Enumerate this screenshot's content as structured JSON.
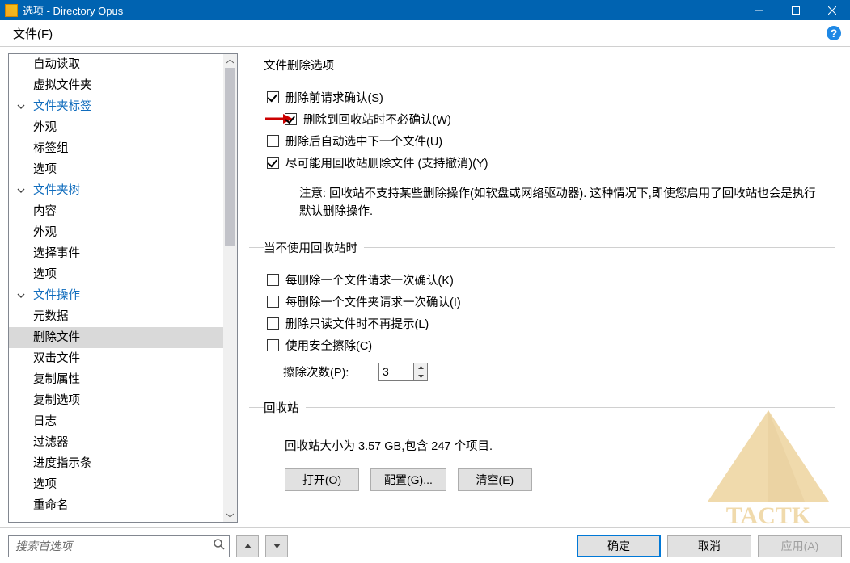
{
  "titlebar": {
    "text": "选项 - Directory Opus"
  },
  "menubar": {
    "file": "文件(F)"
  },
  "sidebar": {
    "items": [
      {
        "kind": "item",
        "label": "自动读取"
      },
      {
        "kind": "item",
        "label": "虚拟文件夹"
      },
      {
        "kind": "group",
        "label": "文件夹标签"
      },
      {
        "kind": "item",
        "label": "外观"
      },
      {
        "kind": "item",
        "label": "标签组"
      },
      {
        "kind": "item",
        "label": "选项"
      },
      {
        "kind": "group",
        "label": "文件夹树"
      },
      {
        "kind": "item",
        "label": "内容"
      },
      {
        "kind": "item",
        "label": "外观"
      },
      {
        "kind": "item",
        "label": "选择事件"
      },
      {
        "kind": "item",
        "label": "选项"
      },
      {
        "kind": "group",
        "label": "文件操作"
      },
      {
        "kind": "item",
        "label": "元数据"
      },
      {
        "kind": "item",
        "label": "删除文件",
        "selected": true
      },
      {
        "kind": "item",
        "label": "双击文件"
      },
      {
        "kind": "item",
        "label": "复制属性"
      },
      {
        "kind": "item",
        "label": "复制选项"
      },
      {
        "kind": "item",
        "label": "日志"
      },
      {
        "kind": "item",
        "label": "过滤器"
      },
      {
        "kind": "item",
        "label": "进度指示条"
      },
      {
        "kind": "item",
        "label": "选项"
      },
      {
        "kind": "item",
        "label": "重命名"
      }
    ]
  },
  "content": {
    "g1": {
      "legend": "文件删除选项",
      "c1": "删除前请求确认(S)",
      "c2": "删除到回收站时不必确认(W)",
      "c3": "删除后自动选中下一个文件(U)",
      "c4": "尽可能用回收站删除文件 (支持撤消)(Y)",
      "note": "注意: 回收站不支持某些删除操作(如软盘或网络驱动器). 这种情况下,即使您启用了回收站也会是执行默认删除操作."
    },
    "g2": {
      "legend": "当不使用回收站时",
      "c1": "每删除一个文件请求一次确认(K)",
      "c2": "每删除一个文件夹请求一次确认(I)",
      "c3": "删除只读文件时不再提示(L)",
      "c4": "使用安全擦除(C)",
      "spin_label": "擦除次数(P):",
      "spin_value": "3"
    },
    "g3": {
      "legend": "回收站",
      "info": "回收站大小为 3.57 GB,包含 247 个项目.",
      "b1": "打开(O)",
      "b2": "配置(G)...",
      "b3": "清空(E)"
    }
  },
  "footer": {
    "search_placeholder": "搜索首选项",
    "ok": "确定",
    "cancel": "取消",
    "apply": "应用(A)"
  },
  "watermark_text": "TACTK"
}
